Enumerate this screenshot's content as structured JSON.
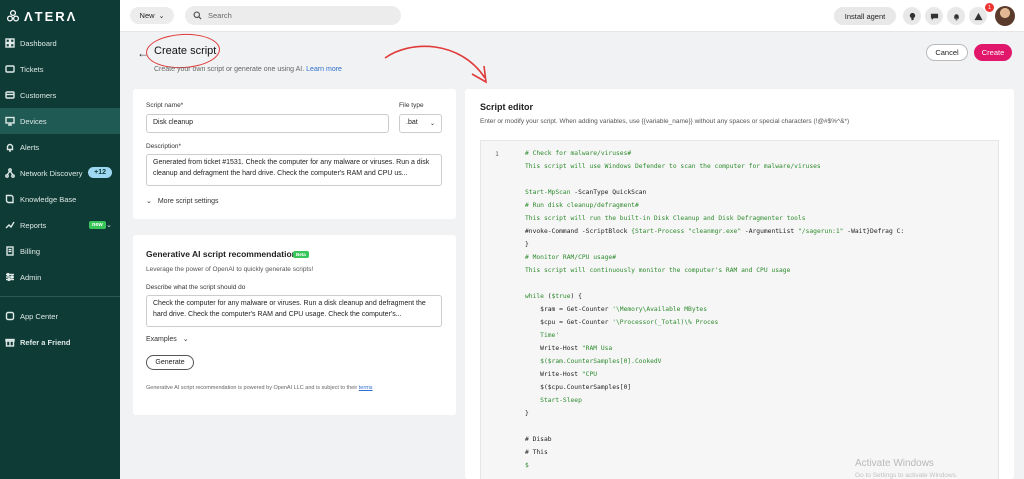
{
  "brand": "ΛTERΛ",
  "sidebar": {
    "items": [
      {
        "label": "Dashboard",
        "icon": "grid-icon"
      },
      {
        "label": "Tickets",
        "icon": "ticket-icon"
      },
      {
        "label": "Customers",
        "icon": "customers-icon"
      },
      {
        "label": "Devices",
        "icon": "monitor-icon",
        "active": true
      },
      {
        "label": "Alerts",
        "icon": "bell-icon"
      },
      {
        "label": "Network Discovery",
        "icon": "network-icon",
        "badge": "+12"
      },
      {
        "label": "Knowledge Base",
        "icon": "book-icon"
      },
      {
        "label": "Reports",
        "icon": "reports-icon",
        "tag": "new"
      },
      {
        "label": "Billing",
        "icon": "billing-icon"
      },
      {
        "label": "Admin",
        "icon": "admin-icon"
      }
    ],
    "bottom": [
      {
        "label": "App Center",
        "icon": "app-center-icon"
      },
      {
        "label": "Refer a Friend",
        "icon": "gift-icon"
      }
    ]
  },
  "topbar": {
    "new_label": "New",
    "search_placeholder": "Search",
    "install_label": "Install agent",
    "notif_count": "1"
  },
  "header": {
    "title": "Create script",
    "subtitle": "Create your own script or generate one using AI.",
    "learn_more": "Learn more",
    "cancel_label": "Cancel",
    "create_label": "Create"
  },
  "form": {
    "script_name_label": "Script name*",
    "script_name_value": "Disk cleanup",
    "file_type_label": "File type",
    "file_type_value": ".bat",
    "description_label": "Description*",
    "description_value": "Generated from ticket #1531. Check the computer for any malware or viruses. Run a disk cleanup and defragment the hard drive. Check the computer's RAM and CPU us...",
    "more_settings": "More script settings"
  },
  "ai": {
    "title": "Generative AI script recommendation",
    "beta": "Beta",
    "subtitle": "Leverage the power of OpenAI to quickly generate scripts!",
    "prompt_label": "Describe what the script should do",
    "prompt_value": "Check the computer for any malware or viruses. Run a disk cleanup and defragment the hard drive. Check the computer's RAM and CPU usage. Check the computer's...",
    "examples": "Examples",
    "generate": "Generate",
    "footer": "Generative AI script recommendation is powered by OpenAI LLC and is subject to their",
    "terms": "terms"
  },
  "editor": {
    "title": "Script editor",
    "subtitle": "Enter or modify your script. When adding variables, use {{variable_name}} without any spaces or special characters (!@#$%^&*)",
    "line_number": "1"
  },
  "watermark": {
    "title": "Activate Windows",
    "sub": "Go to Settings to activate Windows."
  },
  "colors": {
    "sidebar_bg": "#0e3b36",
    "accent": "#e0176a",
    "link": "#2f6fd1",
    "code_green": "#2e8b2e"
  }
}
